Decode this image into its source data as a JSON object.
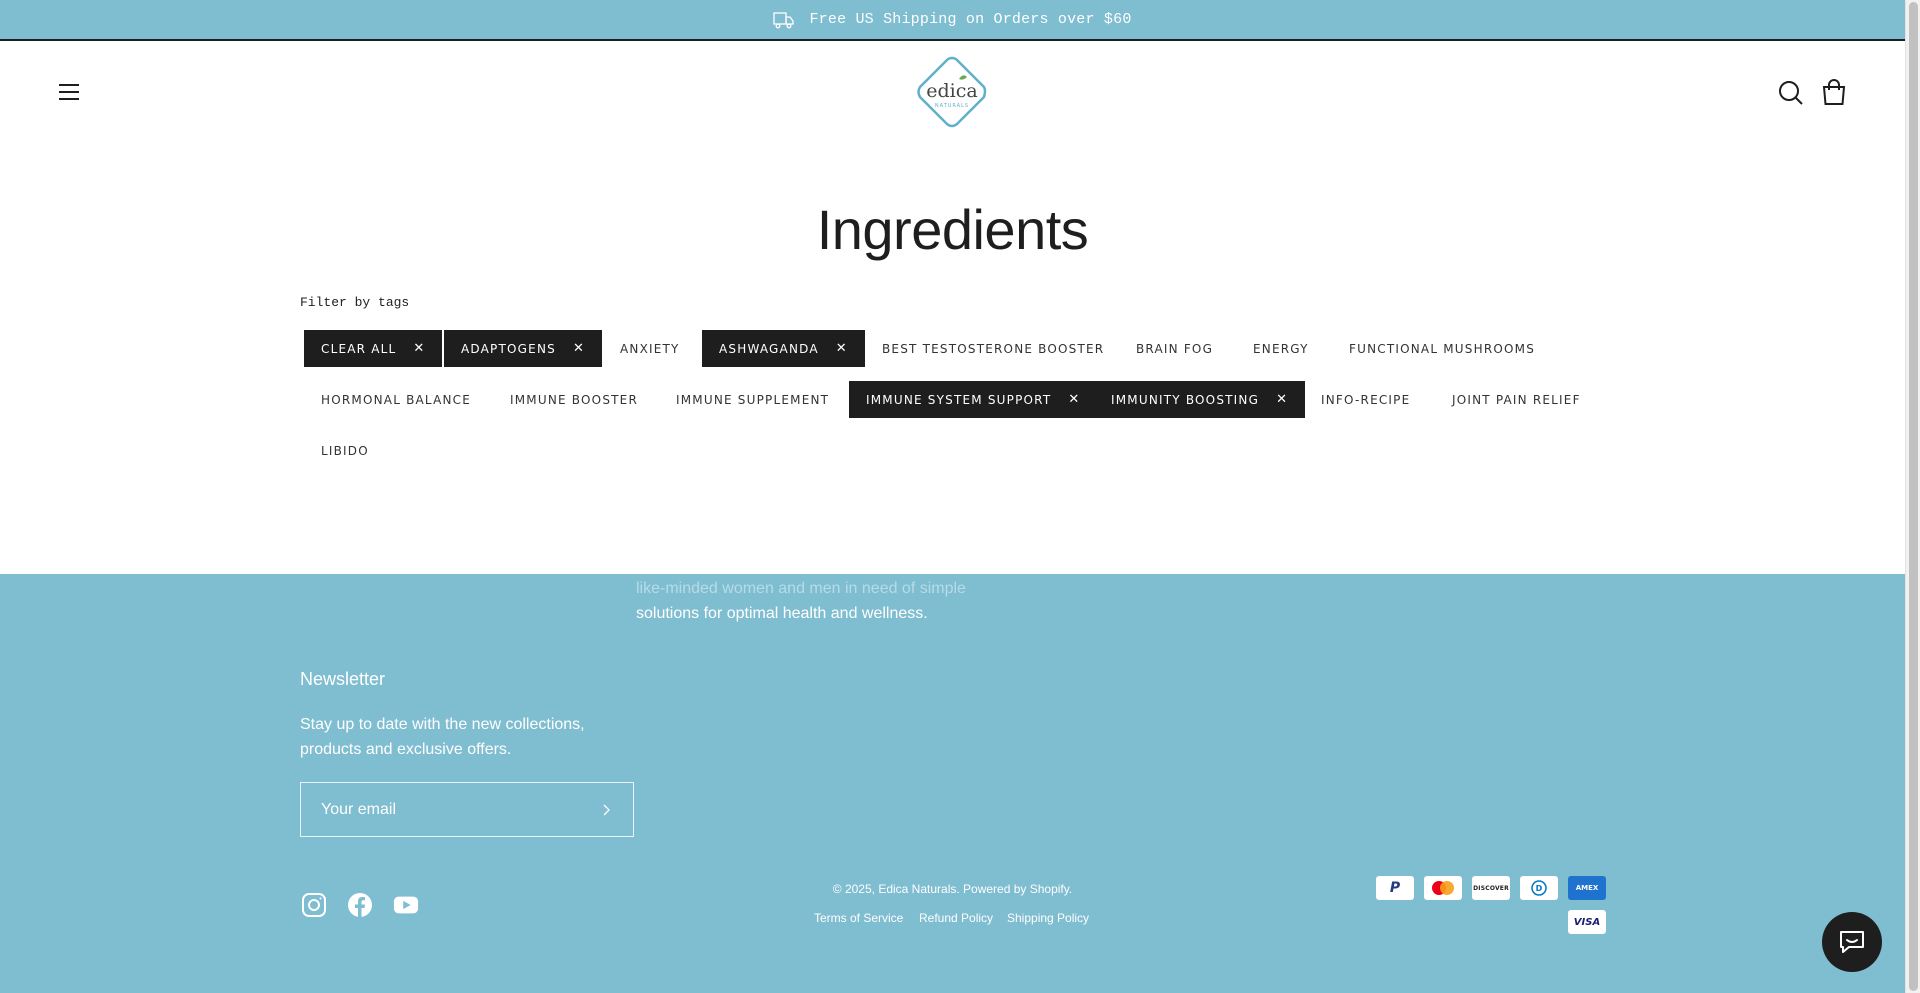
{
  "announcement": {
    "text": "Free US Shipping on Orders over $60"
  },
  "header": {
    "logo_word": "edica",
    "logo_sub": "NATURALS"
  },
  "page": {
    "title": "Ingredients",
    "filter_label": "Filter by tags"
  },
  "tags": {
    "clear_all": "CLEAR ALL",
    "adaptogens": "ADAPTOGENS",
    "anxiety": "ANXIETY",
    "ashwaganda": "ASHWAGANDA",
    "best_testosterone_booster": "BEST TESTOSTERONE BOOSTER",
    "brain_fog": "BRAIN FOG",
    "energy": "ENERGY",
    "functional_mushrooms": "FUNCTIONAL MUSHROOMS",
    "hormonal_balance": "HORMONAL BALANCE",
    "immune_booster": "IMMUNE BOOSTER",
    "immune_supplement": "IMMUNE SUPPLEMENT",
    "immune_system_support": "IMMUNE SYSTEM SUPPORT",
    "immunity_boosting": "IMMUNITY BOOSTING",
    "info_recipe": "INFO-RECIPE",
    "joint_pain_relief": "JOINT PAIN RELIEF",
    "libido": "LIBIDO",
    "remove_symbol": "✕"
  },
  "footer": {
    "about_line_1": "like-minded women and men in need of simple",
    "about_line_2": "solutions for optimal health and wellness.",
    "newsletter_title": "Newsletter",
    "newsletter_text": "Stay up to date with the new collections, products and exclusive offers.",
    "email_placeholder": "Your email",
    "copyright": "© 2025, Edica Naturals. Powered by Shopify.",
    "terms": "Terms of Service",
    "refund": "Refund Policy",
    "shipping": "Shipping Policy",
    "payments": {
      "paypal": "P",
      "discover": "DISCOVER",
      "diners": "D",
      "amex": "AMEX",
      "visa": "VISA"
    }
  },
  "colors": {
    "accent": "#7fbdd0",
    "dark": "#1e1e1e",
    "logo_teal": "#5fb0c8",
    "logo_green": "#6aa84f"
  },
  "icons": [
    "shipping-truck-icon",
    "menu-icon",
    "search-icon",
    "cart-icon",
    "instagram-icon",
    "facebook-icon",
    "youtube-icon",
    "chevron-right-icon",
    "chat-icon"
  ]
}
